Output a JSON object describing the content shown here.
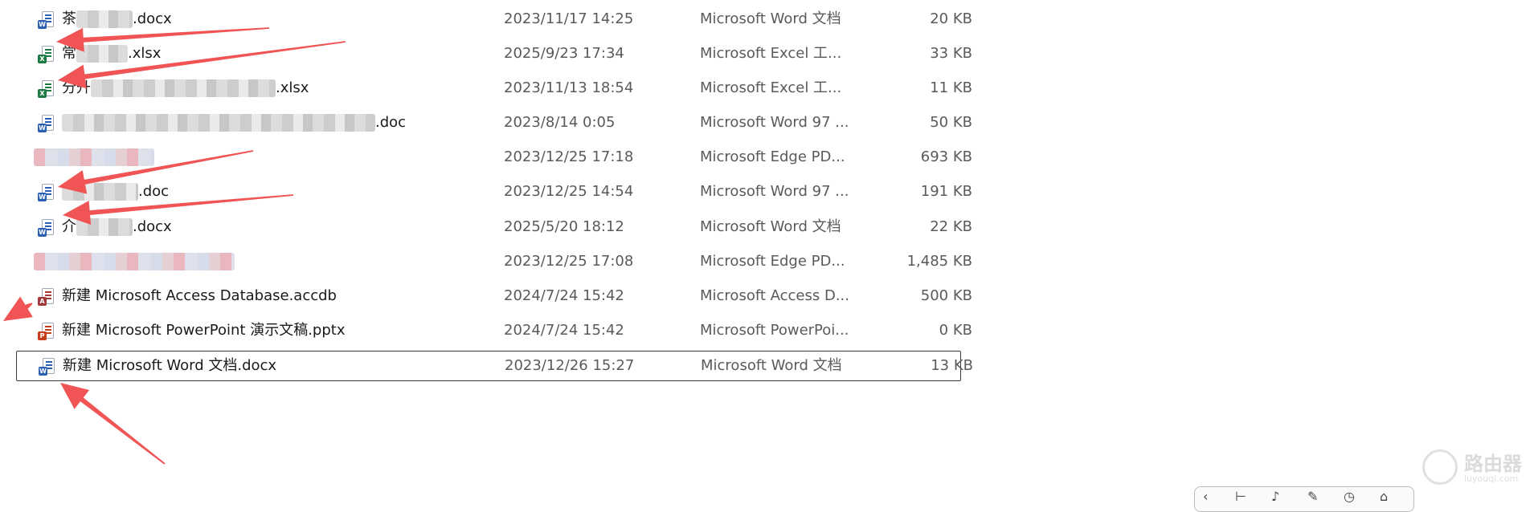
{
  "files": [
    {
      "name_prefix": "茶",
      "name_suffix": ".docx",
      "blur": "gray",
      "blur_w": 70,
      "date": "2023/11/17 14:25",
      "type": "Microsoft Word 文档",
      "size": "20 KB",
      "icon": "word-icon",
      "selected": false
    },
    {
      "name_prefix": "常",
      "name_suffix": ".xlsx",
      "blur": "gray",
      "blur_w": 64,
      "date": "2025/9/23 17:34",
      "type": "Microsoft Excel 工...",
      "size": "33 KB",
      "icon": "excel-icon",
      "selected": false
    },
    {
      "name_prefix": "分升",
      "name_suffix": ".xlsx",
      "blur": "gray",
      "blur_w": 230,
      "date": "2023/11/13 18:54",
      "type": "Microsoft Excel 工...",
      "size": "11 KB",
      "icon": "excel-icon",
      "selected": false
    },
    {
      "name_prefix": "",
      "name_suffix": ".doc",
      "blur": "gray",
      "blur_w": 390,
      "date": "2023/8/14 0:05",
      "type": "Microsoft Word 97 ...",
      "size": "50 KB",
      "icon": "word-icon",
      "selected": false
    },
    {
      "name_prefix": "",
      "name_suffix": "",
      "blur": "pink",
      "blur_w": 150,
      "date": "2023/12/25 17:18",
      "type": "Microsoft Edge PD...",
      "size": "693 KB",
      "icon": "none",
      "selected": false
    },
    {
      "name_prefix": "",
      "name_suffix": ".doc",
      "blur": "gray",
      "blur_w": 95,
      "date": "2023/12/25 14:54",
      "type": "Microsoft Word 97 ...",
      "size": "191 KB",
      "icon": "word-icon",
      "selected": false
    },
    {
      "name_prefix": "介",
      "name_suffix": ".docx",
      "blur": "gray",
      "blur_w": 70,
      "date": "2025/5/20 18:12",
      "type": "Microsoft Word 文档",
      "size": "22 KB",
      "icon": "word-icon",
      "selected": false
    },
    {
      "name_prefix": "",
      "name_suffix": "",
      "blur": "pink",
      "blur_w": 250,
      "date": "2023/12/25 17:08",
      "type": "Microsoft Edge PD...",
      "size": "1,485 KB",
      "icon": "none",
      "selected": false
    },
    {
      "name_prefix": "新建 Microsoft Access Database.accdb",
      "name_suffix": "",
      "blur": "none",
      "blur_w": 0,
      "date": "2024/7/24 15:42",
      "type": "Microsoft Access D...",
      "size": "500 KB",
      "icon": "access-icon",
      "selected": false
    },
    {
      "name_prefix": "新建 Microsoft PowerPoint 演示文稿.pptx",
      "name_suffix": "",
      "blur": "none",
      "blur_w": 0,
      "date": "2024/7/24 15:42",
      "type": "Microsoft PowerPoi...",
      "size": "0 KB",
      "icon": "powerpoint-icon",
      "selected": false
    },
    {
      "name_prefix": "新建 Microsoft Word 文档.docx",
      "name_suffix": "",
      "blur": "none",
      "blur_w": 0,
      "date": "2023/12/26 15:27",
      "type": "Microsoft Word 文档",
      "size": "13 KB",
      "icon": "word-icon",
      "selected": true
    }
  ],
  "icon_colors": {
    "word": "#2b5fb3",
    "excel": "#1e7a45",
    "access": "#a4373a",
    "powerpoint": "#c43e1c"
  },
  "annotation_color": "#f05454",
  "watermark": {
    "title": "路由器",
    "subtitle": "luyouqi.com"
  }
}
